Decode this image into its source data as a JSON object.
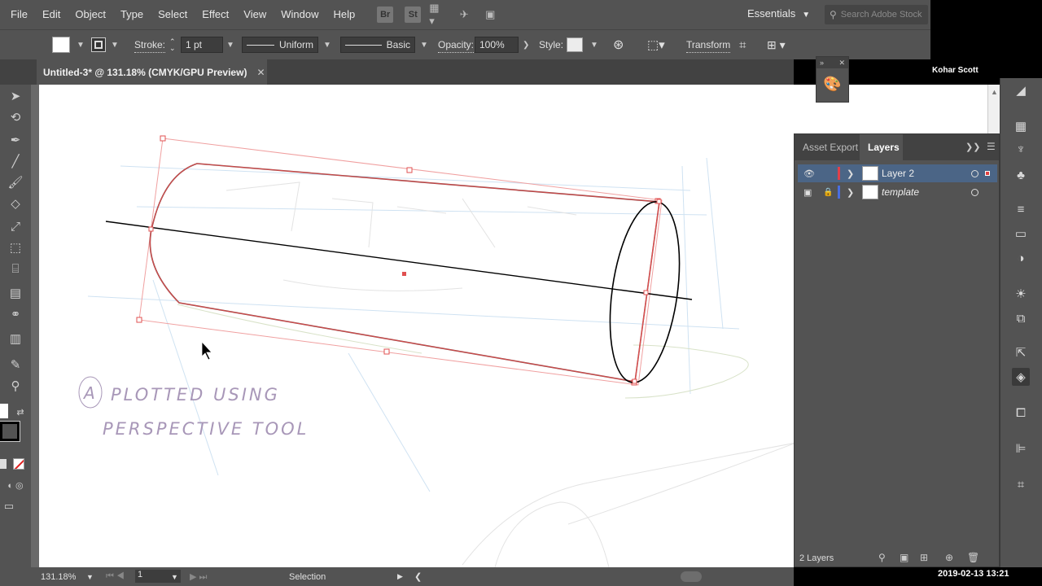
{
  "menu": [
    "File",
    "Edit",
    "Object",
    "Type",
    "Select",
    "Effect",
    "View",
    "Window",
    "Help"
  ],
  "app_buttons": [
    "Br",
    "St"
  ],
  "workspace": "Essentials",
  "search_placeholder": "Search Adobe Stock",
  "control": {
    "stroke_label": "Stroke:",
    "stroke_weight": "1 pt",
    "profile": "Uniform",
    "brush": "Basic",
    "opacity_label": "Opacity:",
    "opacity_value": "100%",
    "style_label": "Style:",
    "transform_label": "Transform"
  },
  "document_tab": "Untitled-3* @ 131.18% (CMYK/GPU Preview)",
  "user_name": "Kohar Scott",
  "layers_panel": {
    "tabs": [
      "Asset Export",
      "Layers"
    ],
    "layers": [
      {
        "name": "Layer 2",
        "color": "#e0404a",
        "selected": true
      },
      {
        "name": "template",
        "color": "#4a6ee0",
        "selected": false
      }
    ],
    "footer_count": "2 Layers"
  },
  "status": {
    "zoom": "131.18%",
    "page": "1",
    "mode": "Selection"
  },
  "timestamp": "2019-02-13  13:21",
  "sketch_note": {
    "letter": "A",
    "line1": "PLOTTED USING",
    "line2": "PERSPECTIVE TOOL"
  },
  "colors": {
    "selection_red": "#e05050",
    "layer_highlight": "#4b6586",
    "ui_panel": "#535353"
  }
}
